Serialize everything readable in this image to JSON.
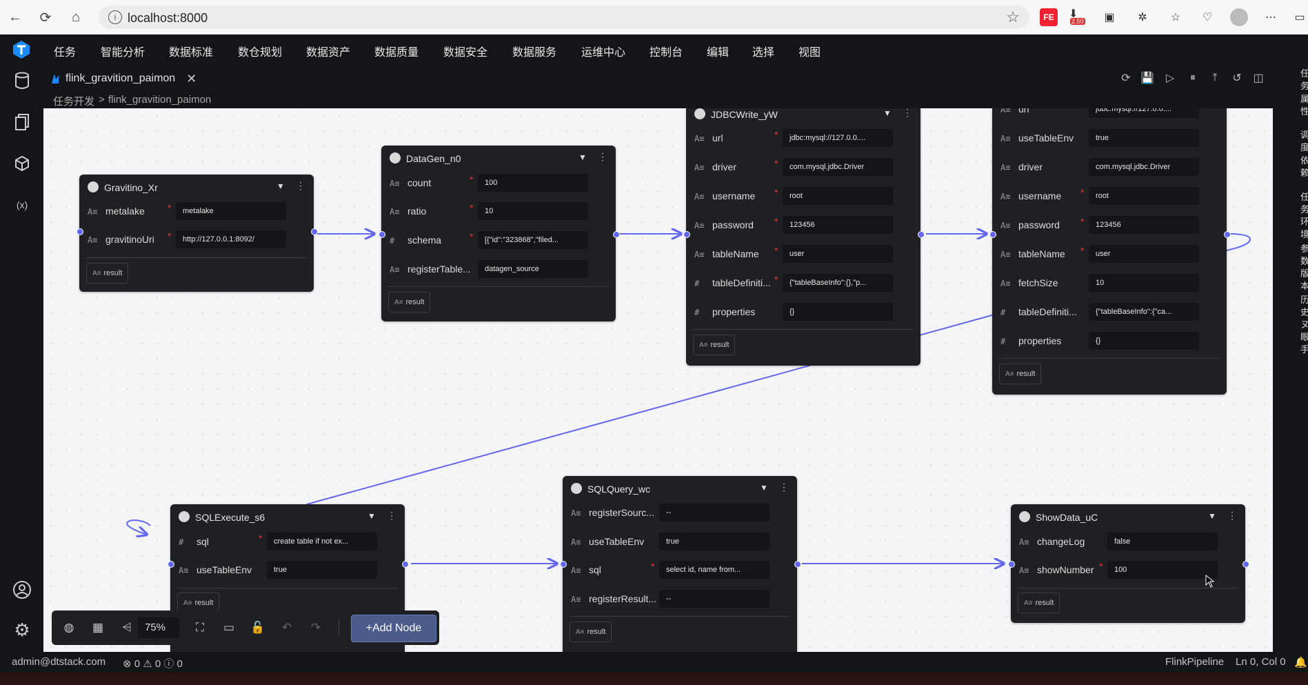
{
  "browser": {
    "url": "localhost:8000",
    "extensions": [
      {
        "name": "fe-extension",
        "label": "FE"
      },
      {
        "name": "downloads-badge",
        "label": "2.50"
      }
    ]
  },
  "app": {
    "menu": [
      "任务",
      "智能分析",
      "数据标准",
      "数仓规划",
      "数据资产",
      "数据质量",
      "数据安全",
      "数据服务",
      "运维中心",
      "控制台",
      "编辑",
      "选择",
      "视图"
    ],
    "tab": {
      "title": "flink_gravition_paimon",
      "close": "✕"
    },
    "breadcrumb": [
      "任务开发",
      "flink_gravition_paimon"
    ],
    "breadcrumb_sep": ">"
  },
  "nodes": {
    "gravitino": {
      "title": "Gravitino_Xr",
      "fields": [
        {
          "type": "A≡",
          "label": "metalake",
          "required": true,
          "value": "metalake"
        },
        {
          "type": "A≡",
          "label": "gravitinoUri",
          "required": true,
          "value": "http://127.0.0.1:8092/"
        }
      ],
      "result": "result"
    },
    "datagen": {
      "title": "DataGen_n0",
      "fields": [
        {
          "type": "A≡",
          "label": "count",
          "required": true,
          "value": "100"
        },
        {
          "type": "A≡",
          "label": "ratio",
          "required": true,
          "value": "10"
        },
        {
          "type": "#",
          "label": "schema",
          "required": true,
          "value": "[{\"id\":\"323868\",\"filed..."
        },
        {
          "type": "A≡",
          "label": "registerTable...",
          "required": false,
          "value": "datagen_source"
        }
      ],
      "result": "result"
    },
    "jdbcwrite": {
      "title": "JDBCWrite_yW",
      "fields": [
        {
          "type": "A≡",
          "label": "url",
          "required": true,
          "value": "jdbc:mysql://127.0.0...."
        },
        {
          "type": "A≡",
          "label": "driver",
          "required": true,
          "value": "com.mysql.jdbc.Driver"
        },
        {
          "type": "A≡",
          "label": "username",
          "required": true,
          "value": "root"
        },
        {
          "type": "A≡",
          "label": "password",
          "required": true,
          "value": "123456"
        },
        {
          "type": "A≡",
          "label": "tableName",
          "required": true,
          "value": "user"
        },
        {
          "type": "#",
          "label": "tableDefiniti...",
          "required": true,
          "value": "{\"tableBaseInfo\":{},\"p..."
        },
        {
          "type": "#",
          "label": "properties",
          "required": false,
          "value": "{}"
        }
      ],
      "result": "result"
    },
    "jdbcread": {
      "fields": [
        {
          "type": "A≡",
          "label": "url",
          "required": true,
          "value": "jdbc:mysql://127.0.0...."
        },
        {
          "type": "A≡",
          "label": "useTableEnv",
          "required": false,
          "value": "true"
        },
        {
          "type": "A≡",
          "label": "driver",
          "required": false,
          "value": "com.mysql.jdbc.Driver"
        },
        {
          "type": "A≡",
          "label": "username",
          "required": true,
          "value": "root"
        },
        {
          "type": "A≡",
          "label": "password",
          "required": true,
          "value": "123456"
        },
        {
          "type": "A≡",
          "label": "tableName",
          "required": true,
          "value": "user"
        },
        {
          "type": "A≡",
          "label": "fetchSize",
          "required": false,
          "value": "10"
        },
        {
          "type": "#",
          "label": "tableDefiniti...",
          "required": false,
          "value": "{\"tableBaseInfo\":{\"ca..."
        },
        {
          "type": "#",
          "label": "properties",
          "required": false,
          "value": "{}"
        }
      ],
      "result": "result"
    },
    "sqlexecute": {
      "title": "SQLExecute_s6",
      "fields": [
        {
          "type": "#",
          "label": "sql",
          "required": true,
          "value": "create table if not ex..."
        },
        {
          "type": "A≡",
          "label": "useTableEnv",
          "required": false,
          "value": "true"
        }
      ],
      "result": "result"
    },
    "sqlquery": {
      "title": "SQLQuery_wc",
      "fields": [
        {
          "type": "A≡",
          "label": "registerSourc...",
          "required": false,
          "value": "--"
        },
        {
          "type": "A≡",
          "label": "useTableEnv",
          "required": false,
          "value": "true"
        },
        {
          "type": "A≡",
          "label": "sql",
          "required": true,
          "value": "select id, name from..."
        },
        {
          "type": "A≡",
          "label": "registerResult...",
          "required": false,
          "value": "--"
        }
      ],
      "result": "result"
    },
    "showdata": {
      "title": "ShowData_uC",
      "fields": [
        {
          "type": "A≡",
          "label": "changeLog",
          "required": false,
          "value": "false"
        },
        {
          "type": "A≡",
          "label": "showNumber",
          "required": true,
          "value": "100"
        }
      ],
      "result": "result"
    }
  },
  "toolbar": {
    "zoom": "75%",
    "add_node": "+Add Node"
  },
  "status": {
    "user": "admin@dtstack.com",
    "problems": "⊗ 0 ⚠ 0 ⓘ 0",
    "language": "FlinkPipeline",
    "position": "Ln 0, Col 0"
  },
  "right_panel_chars": [
    "任",
    "务",
    "属",
    "性",
    "调",
    "度",
    "依",
    "赖",
    "任",
    "务",
    "环",
    "境",
    "参",
    "数",
    "版",
    "本",
    "历",
    "史",
    "ヌ",
    "眼",
    "手"
  ]
}
